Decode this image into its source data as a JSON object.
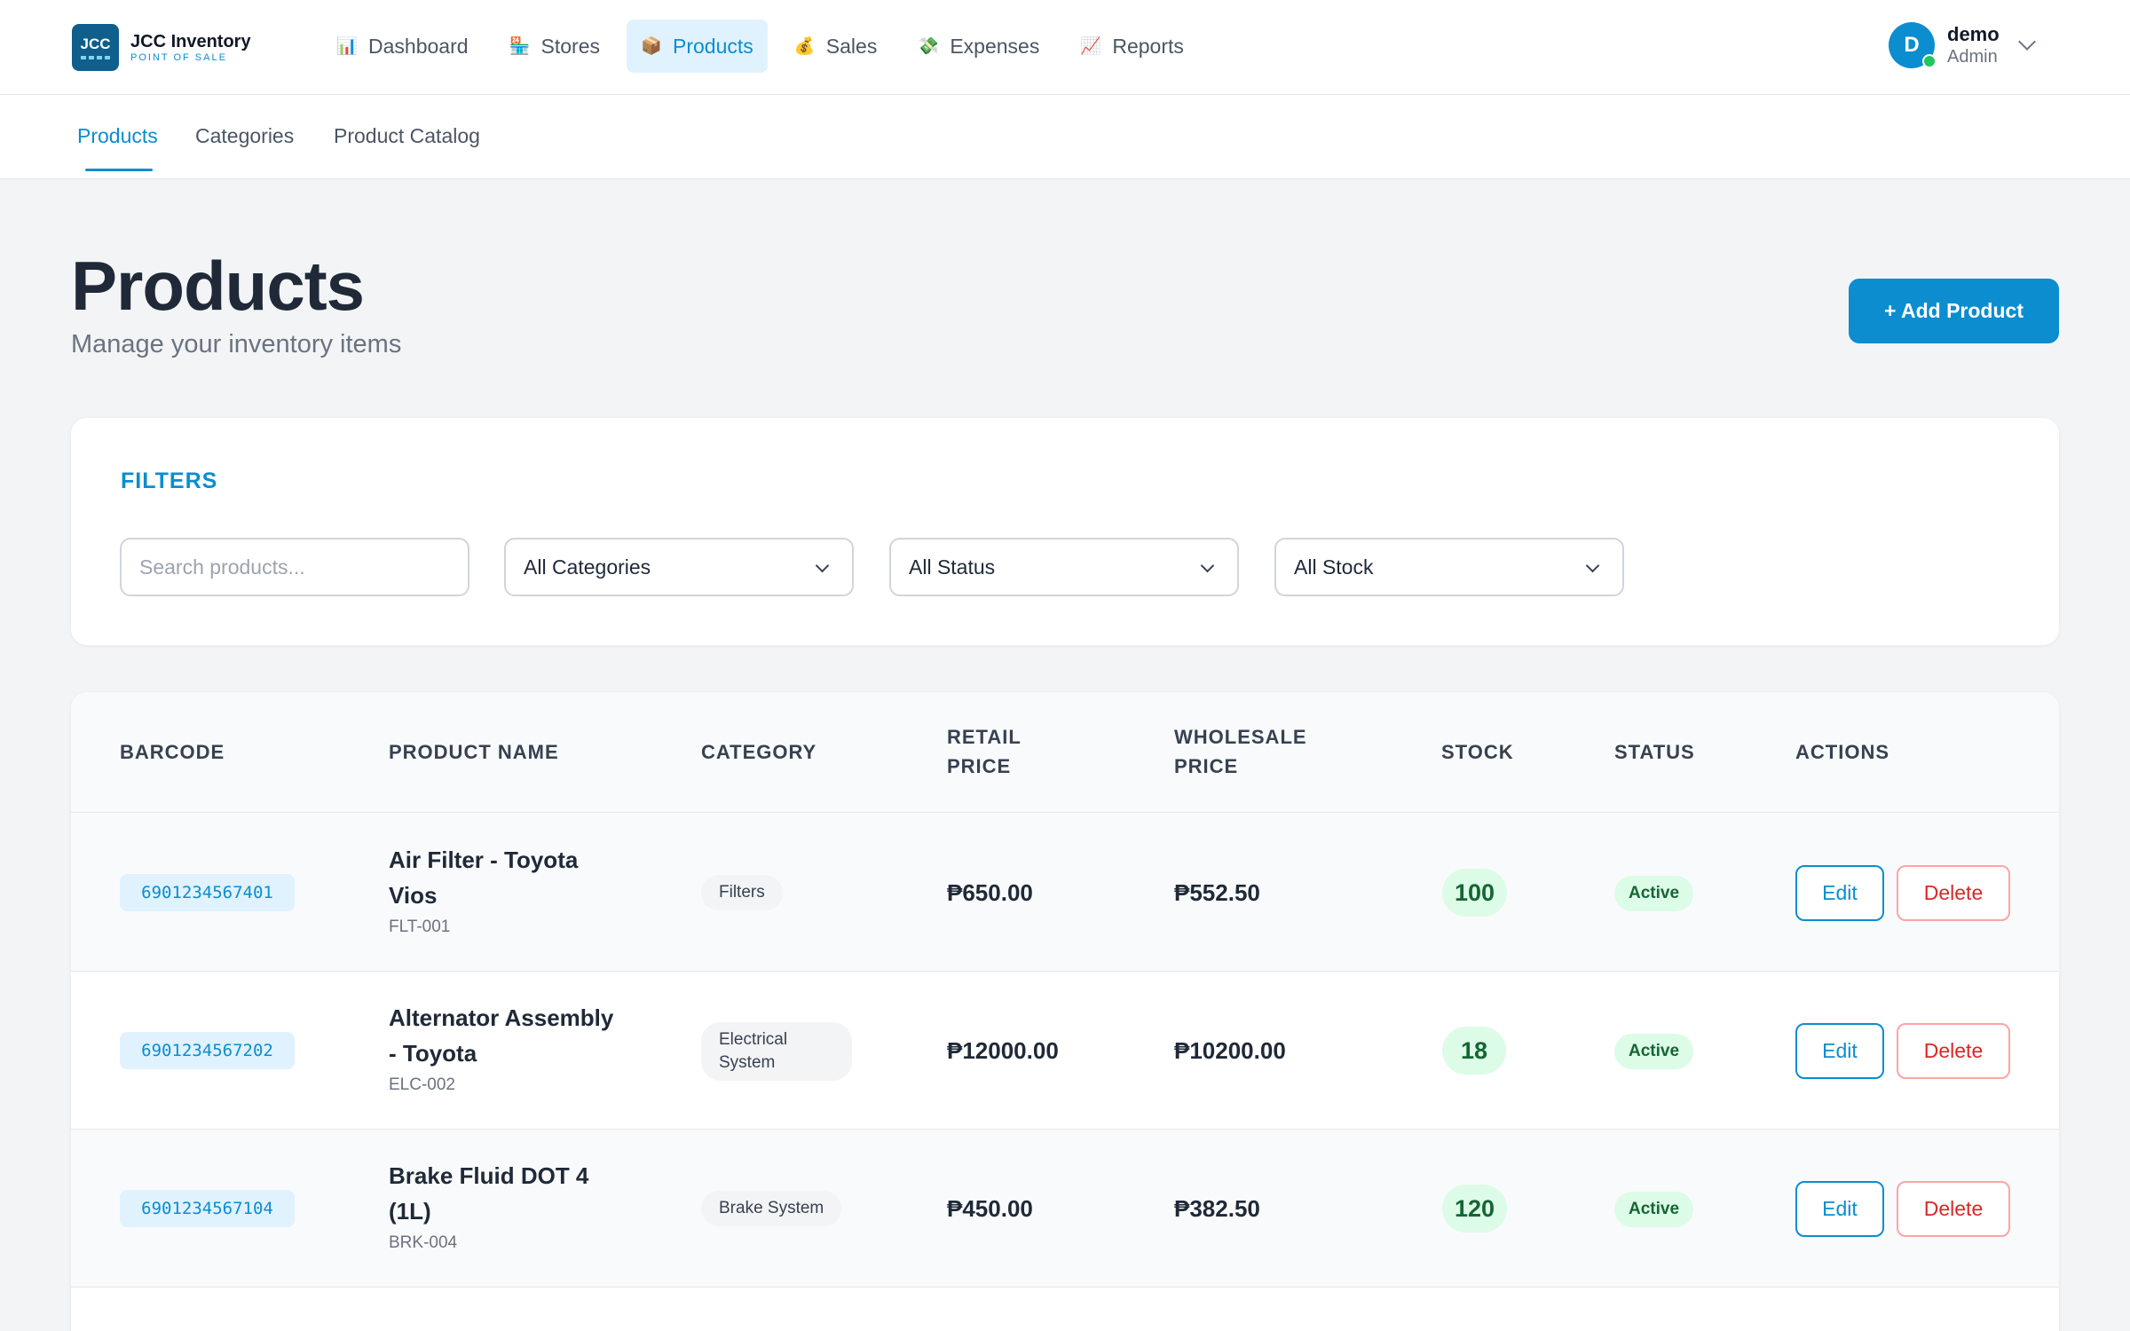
{
  "app": {
    "logo_mark": "JCC",
    "logo_title": "JCC Inventory",
    "logo_sub": "POINT OF SALE"
  },
  "nav": {
    "items": [
      {
        "label": "Dashboard",
        "icon": "📊",
        "icon_name": "dashboard-chart-icon"
      },
      {
        "label": "Stores",
        "icon": "🏪",
        "icon_name": "store-icon"
      },
      {
        "label": "Products",
        "icon": "📦",
        "icon_name": "package-icon",
        "active": true
      },
      {
        "label": "Sales",
        "icon": "💰",
        "icon_name": "money-bag-icon"
      },
      {
        "label": "Expenses",
        "icon": "💸",
        "icon_name": "money-wings-icon"
      },
      {
        "label": "Reports",
        "icon": "📈",
        "icon_name": "trend-chart-icon"
      }
    ]
  },
  "user": {
    "initial": "D",
    "name": "demo",
    "role": "Admin"
  },
  "subnav": {
    "tabs": [
      {
        "label": "Products",
        "active": true
      },
      {
        "label": "Categories"
      },
      {
        "label": "Product Catalog"
      }
    ]
  },
  "header": {
    "title": "Products",
    "subtitle": "Manage your inventory items",
    "add_button": "+ Add Product"
  },
  "filters": {
    "label": "FILTERS",
    "search_placeholder": "Search products...",
    "category_value": "All Categories",
    "status_value": "All Status",
    "stock_value": "All Stock"
  },
  "table": {
    "headers": {
      "barcode": "BARCODE",
      "product_name": "PRODUCT NAME",
      "category": "CATEGORY",
      "retail_line1": "RETAIL",
      "retail_line2": "PRICE",
      "wholesale_line1": "WHOLESALE",
      "wholesale_line2": "PRICE",
      "stock": "STOCK",
      "status": "STATUS",
      "actions": "ACTIONS"
    },
    "rows": [
      {
        "barcode": "6901234567401",
        "name": "Air Filter - Toyota Vios",
        "sku": "FLT-001",
        "category": "Filters",
        "retail": "₱650.00",
        "wholesale": "₱552.50",
        "stock": "100",
        "status": "Active",
        "edit": "Edit",
        "delete": "Delete"
      },
      {
        "barcode": "6901234567202",
        "name": "Alternator Assembly - Toyota",
        "sku": "ELC-002",
        "category": "Electrical System",
        "retail": "₱12000.00",
        "wholesale": "₱10200.00",
        "stock": "18",
        "status": "Active",
        "edit": "Edit",
        "delete": "Delete"
      },
      {
        "barcode": "6901234567104",
        "name": "Brake Fluid DOT 4 (1L)",
        "sku": "BRK-004",
        "category": "Brake System",
        "retail": "₱450.00",
        "wholesale": "₱382.50",
        "stock": "120",
        "status": "Active",
        "edit": "Edit",
        "delete": "Delete"
      }
    ]
  },
  "colors": {
    "accent": "#0b8dd0",
    "success_bg": "#dcfce7",
    "success_text": "#166534",
    "danger": "#dc2626"
  }
}
